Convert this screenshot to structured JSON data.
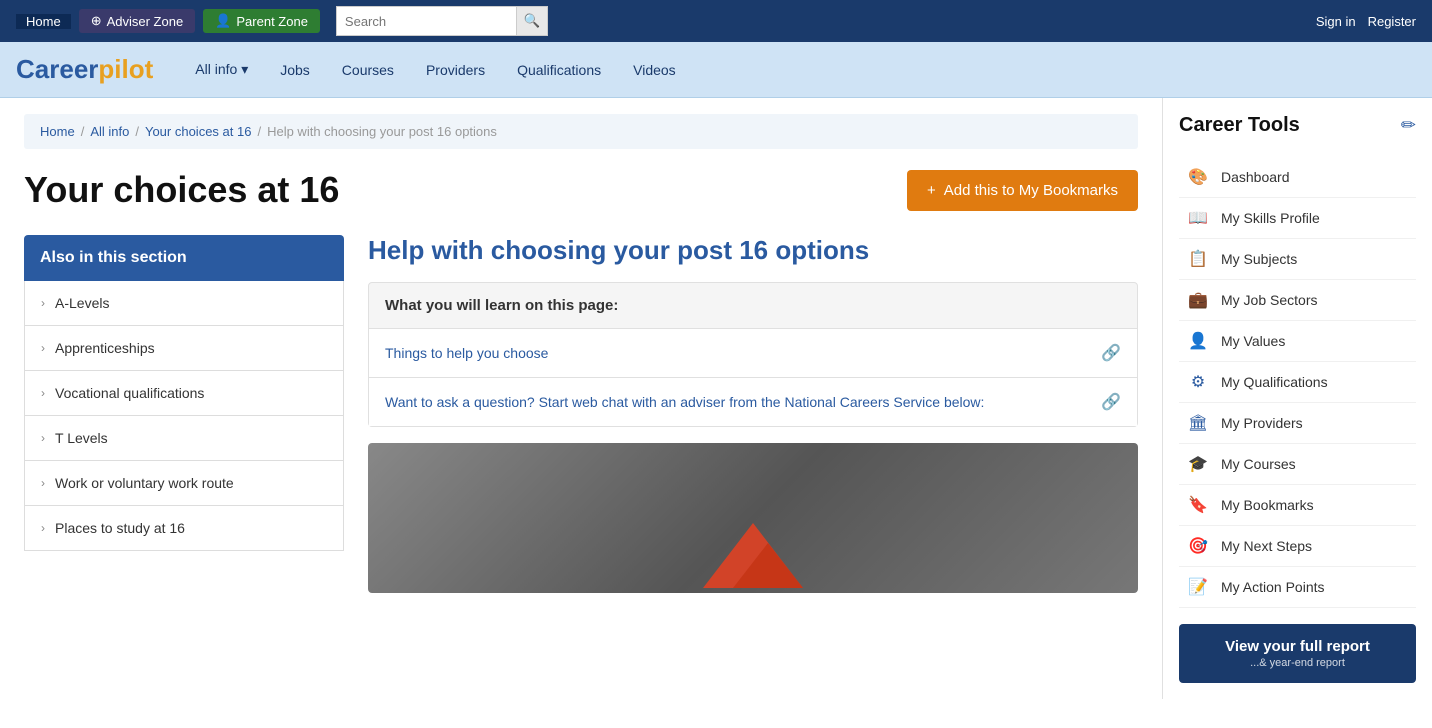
{
  "topbar": {
    "home_label": "Home",
    "adviser_label": "Adviser Zone",
    "parent_label": "Parent Zone",
    "search_placeholder": "Search",
    "signin_label": "Sign in",
    "register_label": "Register"
  },
  "mainnav": {
    "logo_career": "Career",
    "logo_pilot": "pilot",
    "links": [
      {
        "label": "All info ▾",
        "id": "all-info"
      },
      {
        "label": "Jobs",
        "id": "jobs"
      },
      {
        "label": "Courses",
        "id": "courses"
      },
      {
        "label": "Providers",
        "id": "providers"
      },
      {
        "label": "Qualifications",
        "id": "qualifications"
      },
      {
        "label": "Videos",
        "id": "videos"
      }
    ]
  },
  "breadcrumb": {
    "items": [
      {
        "label": "Home",
        "href": "#"
      },
      {
        "label": "All info",
        "href": "#"
      },
      {
        "label": "Your choices at 16",
        "href": "#"
      },
      {
        "label": "Help with choosing your post 16 options"
      }
    ]
  },
  "page": {
    "title": "Your choices at 16",
    "bookmark_label": "Add this to My Bookmarks",
    "section_sidebar_heading": "Also in this section",
    "section_items": [
      {
        "label": "A-Levels"
      },
      {
        "label": "Apprenticeships"
      },
      {
        "label": "Vocational qualifications"
      },
      {
        "label": "T Levels"
      },
      {
        "label": "Work or voluntary work route"
      },
      {
        "label": "Places to study at 16"
      }
    ],
    "article_heading": "Help with choosing your post 16 options",
    "learn_box_header": "What you will learn on this page:",
    "learn_links": [
      {
        "label": "Things to help you choose"
      },
      {
        "label": "Want to ask a question? Start web chat with an adviser from the National Careers Service below:"
      }
    ]
  },
  "career_tools": {
    "title": "Career Tools",
    "edit_icon": "✏",
    "items": [
      {
        "label": "Dashboard",
        "icon": "🎨",
        "id": "dashboard"
      },
      {
        "label": "My Skills Profile",
        "icon": "📖",
        "id": "skills-profile"
      },
      {
        "label": "My Subjects",
        "icon": "📋",
        "id": "subjects"
      },
      {
        "label": "My Job Sectors",
        "icon": "💼",
        "id": "job-sectors"
      },
      {
        "label": "My Values",
        "icon": "👤",
        "id": "values"
      },
      {
        "label": "My Qualifications",
        "icon": "⚙",
        "id": "qualifications"
      },
      {
        "label": "My Providers",
        "icon": "🏛",
        "id": "providers"
      },
      {
        "label": "My Courses",
        "icon": "🎓",
        "id": "courses"
      },
      {
        "label": "My Bookmarks",
        "icon": "🔖",
        "id": "bookmarks"
      },
      {
        "label": "My Next Steps",
        "icon": "🎯",
        "id": "next-steps"
      },
      {
        "label": "My Action Points",
        "icon": "📝",
        "id": "action-points"
      }
    ],
    "view_report_main": "View your full report",
    "view_report_sub": "...& year-end report"
  }
}
